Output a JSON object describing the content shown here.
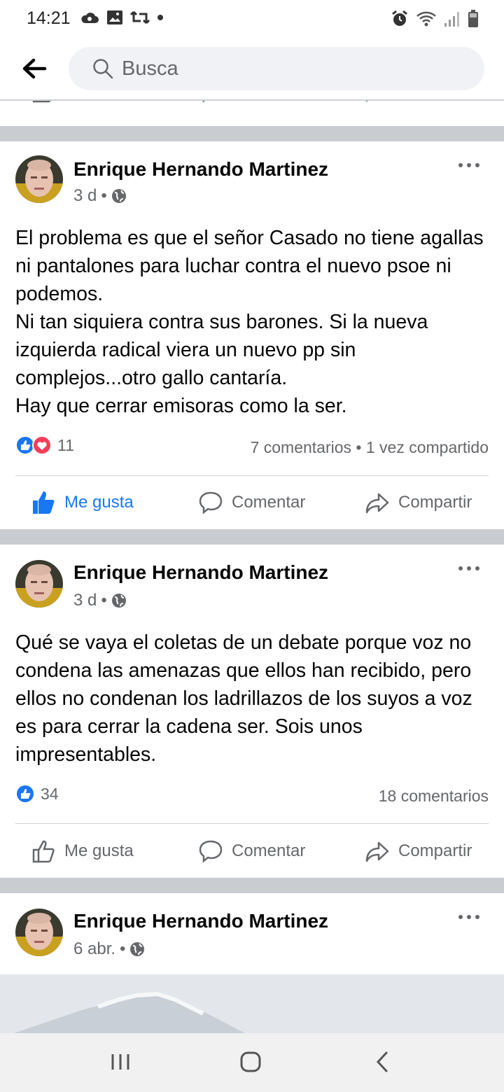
{
  "status_bar": {
    "time": "14:21"
  },
  "header": {
    "search_placeholder": "Busca"
  },
  "actions": {
    "like": "Me gusta",
    "comment": "Comentar",
    "share": "Compartir"
  },
  "posts": [
    {
      "author": "Enrique Hernando Martinez",
      "time": "3 d",
      "separator": "•",
      "text_lines": [
        "El problema es que el señor Casado no tiene agallas ni pantalones para luchar contra el nuevo psoe ni podemos.",
        "Ni tan siquiera contra sus barones. Si la nueva izquierda radical viera un nuevo pp sin complejos...otro gallo cantaría.",
        "Hay que cerrar emisoras como la ser."
      ],
      "reaction_count": "11",
      "stats": "7 comentarios • 1 vez compartido"
    },
    {
      "author": "Enrique Hernando Martinez",
      "time": "3 d",
      "separator": "•",
      "text_lines": [
        "Qué se vaya el coletas de un debate porque voz no condena las amenazas que ellos han recibido, pero ellos no condenan los ladrillazos de los suyos a voz es para cerrar la cadena ser. Sois unos impresentables."
      ],
      "reaction_count": "34",
      "stats": "18 comentarios"
    },
    {
      "author": "Enrique Hernando Martinez",
      "time": "6 abr.",
      "separator": "•"
    }
  ],
  "colors": {
    "accent": "#1877f2",
    "love": "#f33e58",
    "secondary_text": "#65676b",
    "separator": "#c9ccd1"
  }
}
